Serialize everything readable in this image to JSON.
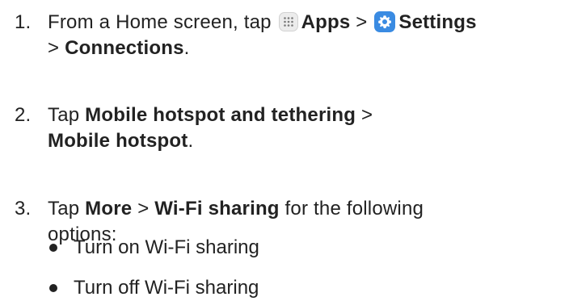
{
  "steps": [
    {
      "number": "1.",
      "line1_prefix": "From a Home screen, tap",
      "apps_label": "Apps",
      "sep1": ">",
      "settings_label": "Settings",
      "line2_sep": ">",
      "connections_label": "Connections",
      "line2_end": "."
    },
    {
      "number": "2.",
      "prefix": "Tap",
      "item1": "Mobile hotspot and tethering",
      "sep": ">",
      "item2": "Mobile hotspot",
      "end": "."
    },
    {
      "number": "3.",
      "prefix": "Tap",
      "item1": "More",
      "sep": ">",
      "item2": "Wi-Fi sharing",
      "suffix": "for the following",
      "line2": "options:"
    }
  ],
  "bullets": [
    "Turn on Wi-Fi sharing",
    "Turn off Wi-Fi sharing"
  ],
  "icons": {
    "apps": "apps-grid-icon",
    "settings": "settings-gear-icon"
  },
  "colors": {
    "text": "#222222",
    "settings_icon_bg": "#3a8be2",
    "apps_icon_bg": "#ececec"
  }
}
